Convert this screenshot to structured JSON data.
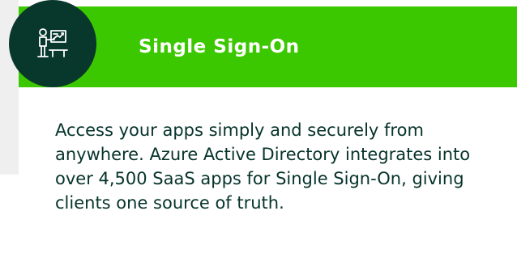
{
  "card": {
    "title": "Single Sign-On",
    "description": "Access your apps simply and securely from anywhere. Azure Active Directory integrates into over 4,500 SaaS apps for Single Sign-On, giving clients one source of truth.",
    "icon": "presentation-icon"
  },
  "colors": {
    "header_green": "#3cc800",
    "icon_circle": "#08372b",
    "text_dark": "#06332a",
    "page_background": "#efefef"
  }
}
